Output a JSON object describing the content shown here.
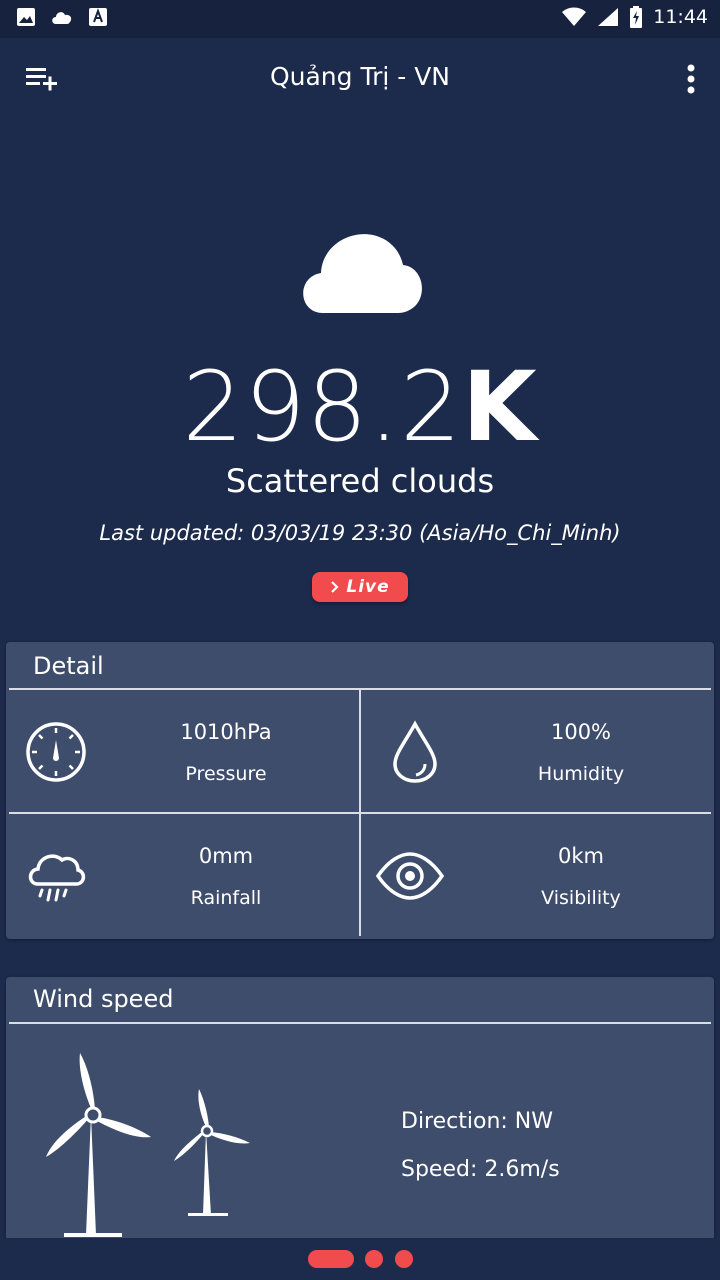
{
  "status_bar": {
    "time": "11:44",
    "left_icons": [
      "image-icon",
      "cloud-icon",
      "font-icon"
    ],
    "right_icons": [
      "wifi-icon",
      "signal-icon",
      "battery-charging-icon"
    ]
  },
  "toolbar": {
    "title": "Quảng Trị - VN",
    "left_icon": "playlist-add-icon",
    "right_icon": "more-vert-icon"
  },
  "current": {
    "icon": "cloud-icon",
    "temp_number": "298.2",
    "temp_unit": "K",
    "description": "Scattered clouds",
    "last_updated": "Last updated: 03/03/19 23:30 (Asia/Ho_Chi_Minh)",
    "live_label": "Live"
  },
  "detail": {
    "title": "Detail",
    "items": [
      {
        "value": "1010hPa",
        "label": "Pressure",
        "icon": "gauge-icon"
      },
      {
        "value": "100%",
        "label": "Humidity",
        "icon": "droplet-icon"
      },
      {
        "value": "0mm",
        "label": "Rainfall",
        "icon": "rain-cloud-icon"
      },
      {
        "value": "0km",
        "label": "Visibility",
        "icon": "eye-icon"
      }
    ]
  },
  "wind": {
    "title": "Wind speed",
    "direction": "Direction: NW",
    "speed": "Speed: 2.6m/s",
    "icon": "wind-turbine-icon"
  },
  "pager": {
    "pages": 3,
    "active_index": 0
  },
  "colors": {
    "background": "#1c2a4c",
    "card": "#3f4d6c",
    "accent": "#f24b4e",
    "text": "#ffffff"
  }
}
